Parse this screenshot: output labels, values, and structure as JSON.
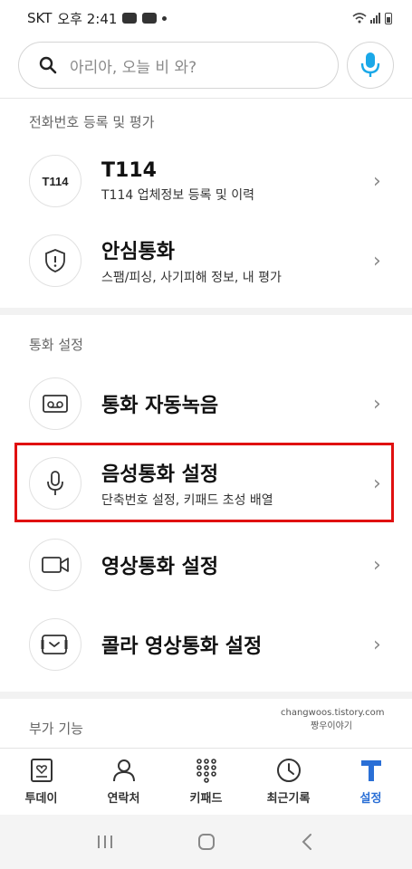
{
  "status_bar": {
    "carrier": "SKT",
    "time": "오후 2:41"
  },
  "search": {
    "placeholder": "아리아, 오늘 비 와?"
  },
  "section1": {
    "title": "전화번호 등록 및 평가",
    "items": [
      {
        "icon_text": "T114",
        "title": "T114",
        "subtitle": "T114 업체정보 등록 및 이력",
        "icon": "t114-icon"
      },
      {
        "title": "안심통화",
        "subtitle": "스팸/피싱, 사기피해 정보, 내 평가",
        "icon": "shield-icon"
      }
    ]
  },
  "section2": {
    "title": "통화 설정",
    "items": [
      {
        "title": "통화 자동녹음",
        "icon": "voicemail-icon"
      },
      {
        "title": "음성통화 설정",
        "subtitle": "단축번호 설정, 키패드 초성 배열",
        "icon": "microphone-icon"
      },
      {
        "title": "영상통화 설정",
        "icon": "video-camera-icon"
      },
      {
        "title": "콜라 영상통화 설정",
        "icon": "video-message-icon"
      }
    ]
  },
  "section3": {
    "title": "부가 기능"
  },
  "watermark": {
    "line1": "changwoos.tistory.com",
    "line2": "짱우이야기"
  },
  "bottom_nav": [
    {
      "label": "투데이",
      "icon": "today-icon"
    },
    {
      "label": "연락처",
      "icon": "contacts-icon"
    },
    {
      "label": "키패드",
      "icon": "keypad-icon"
    },
    {
      "label": "최근기록",
      "icon": "clock-icon"
    },
    {
      "label": "설정",
      "icon": "t-logo-icon",
      "active": true
    }
  ],
  "colors": {
    "accent": "#2a6fd6",
    "highlight": "#e01010"
  }
}
